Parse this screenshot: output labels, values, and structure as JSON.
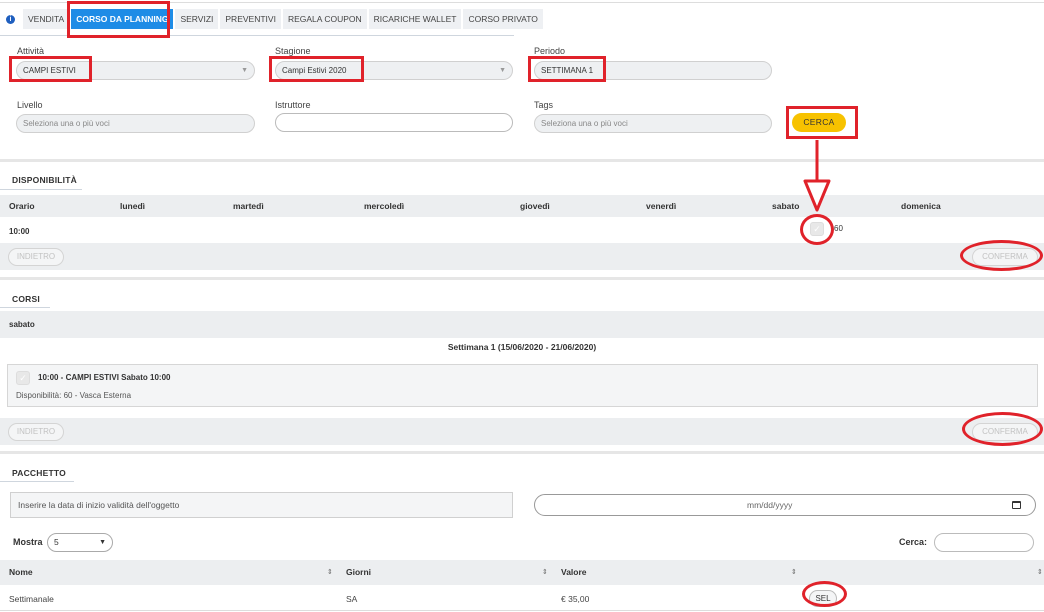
{
  "tabs": [
    {
      "label": "VENDITA",
      "active": false
    },
    {
      "label": "CORSO DA PLANNING",
      "active": true
    },
    {
      "label": "SERVIZI",
      "active": false
    },
    {
      "label": "PREVENTIVI",
      "active": false
    },
    {
      "label": "REGALA COUPON",
      "active": false
    },
    {
      "label": "RICARICHE WALLET",
      "active": false
    },
    {
      "label": "CORSO PRIVATO",
      "active": false
    }
  ],
  "info_icon": "info-icon",
  "filters": {
    "attivita": {
      "label": "Attività",
      "value": "CAMPI ESTIVI"
    },
    "stagione": {
      "label": "Stagione",
      "value": "Campi Estivi 2020"
    },
    "periodo": {
      "label": "Periodo",
      "value": "SETTIMANA 1"
    },
    "livello": {
      "label": "Livello",
      "placeholder": "Seleziona una o più voci"
    },
    "istruttore": {
      "label": "Istruttore",
      "value": ""
    },
    "tags": {
      "label": "Tags",
      "placeholder": "Seleziona una o più voci"
    },
    "search_button": "CERCA"
  },
  "disponibilita": {
    "title": "DISPONIBILITÀ",
    "columns": [
      "Orario",
      "lunedì",
      "martedì",
      "mercoledì",
      "giovedì",
      "venerdì",
      "sabato",
      "domenica"
    ],
    "rows": [
      {
        "time": "10:00",
        "sabato_value": "60"
      }
    ],
    "back_button": "INDIETRO",
    "confirm_button": "CONFERMA"
  },
  "corsi": {
    "title": "CORSI",
    "day": "sabato",
    "week": "Settimana 1 (15/06/2020 - 21/06/2020)",
    "course_title": "10:00 - CAMPI ESTIVI Sabato 10:00",
    "course_detail": "Disponibilità: 60 - Vasca Esterna",
    "back_button": "INDIETRO",
    "confirm_button": "CONFERMA"
  },
  "pacchetto": {
    "title": "PACCHETTO",
    "date_note": "Inserire la data di inizio validità dell'oggetto",
    "date_placeholder": "mm/dd/yyyy",
    "mostra_label": "Mostra",
    "mostra_value": "5",
    "search_label": "Cerca:",
    "columns": [
      "Nome",
      "Giorni",
      "Valore",
      ""
    ],
    "rows": [
      {
        "nome": "Settimanale",
        "giorni": "SA",
        "valore": "€ 35,00",
        "action": "SEL"
      }
    ]
  },
  "colors": {
    "active_tab": "#1e8ce6",
    "search_button": "#f7c200",
    "annotation": "#e0222a"
  }
}
